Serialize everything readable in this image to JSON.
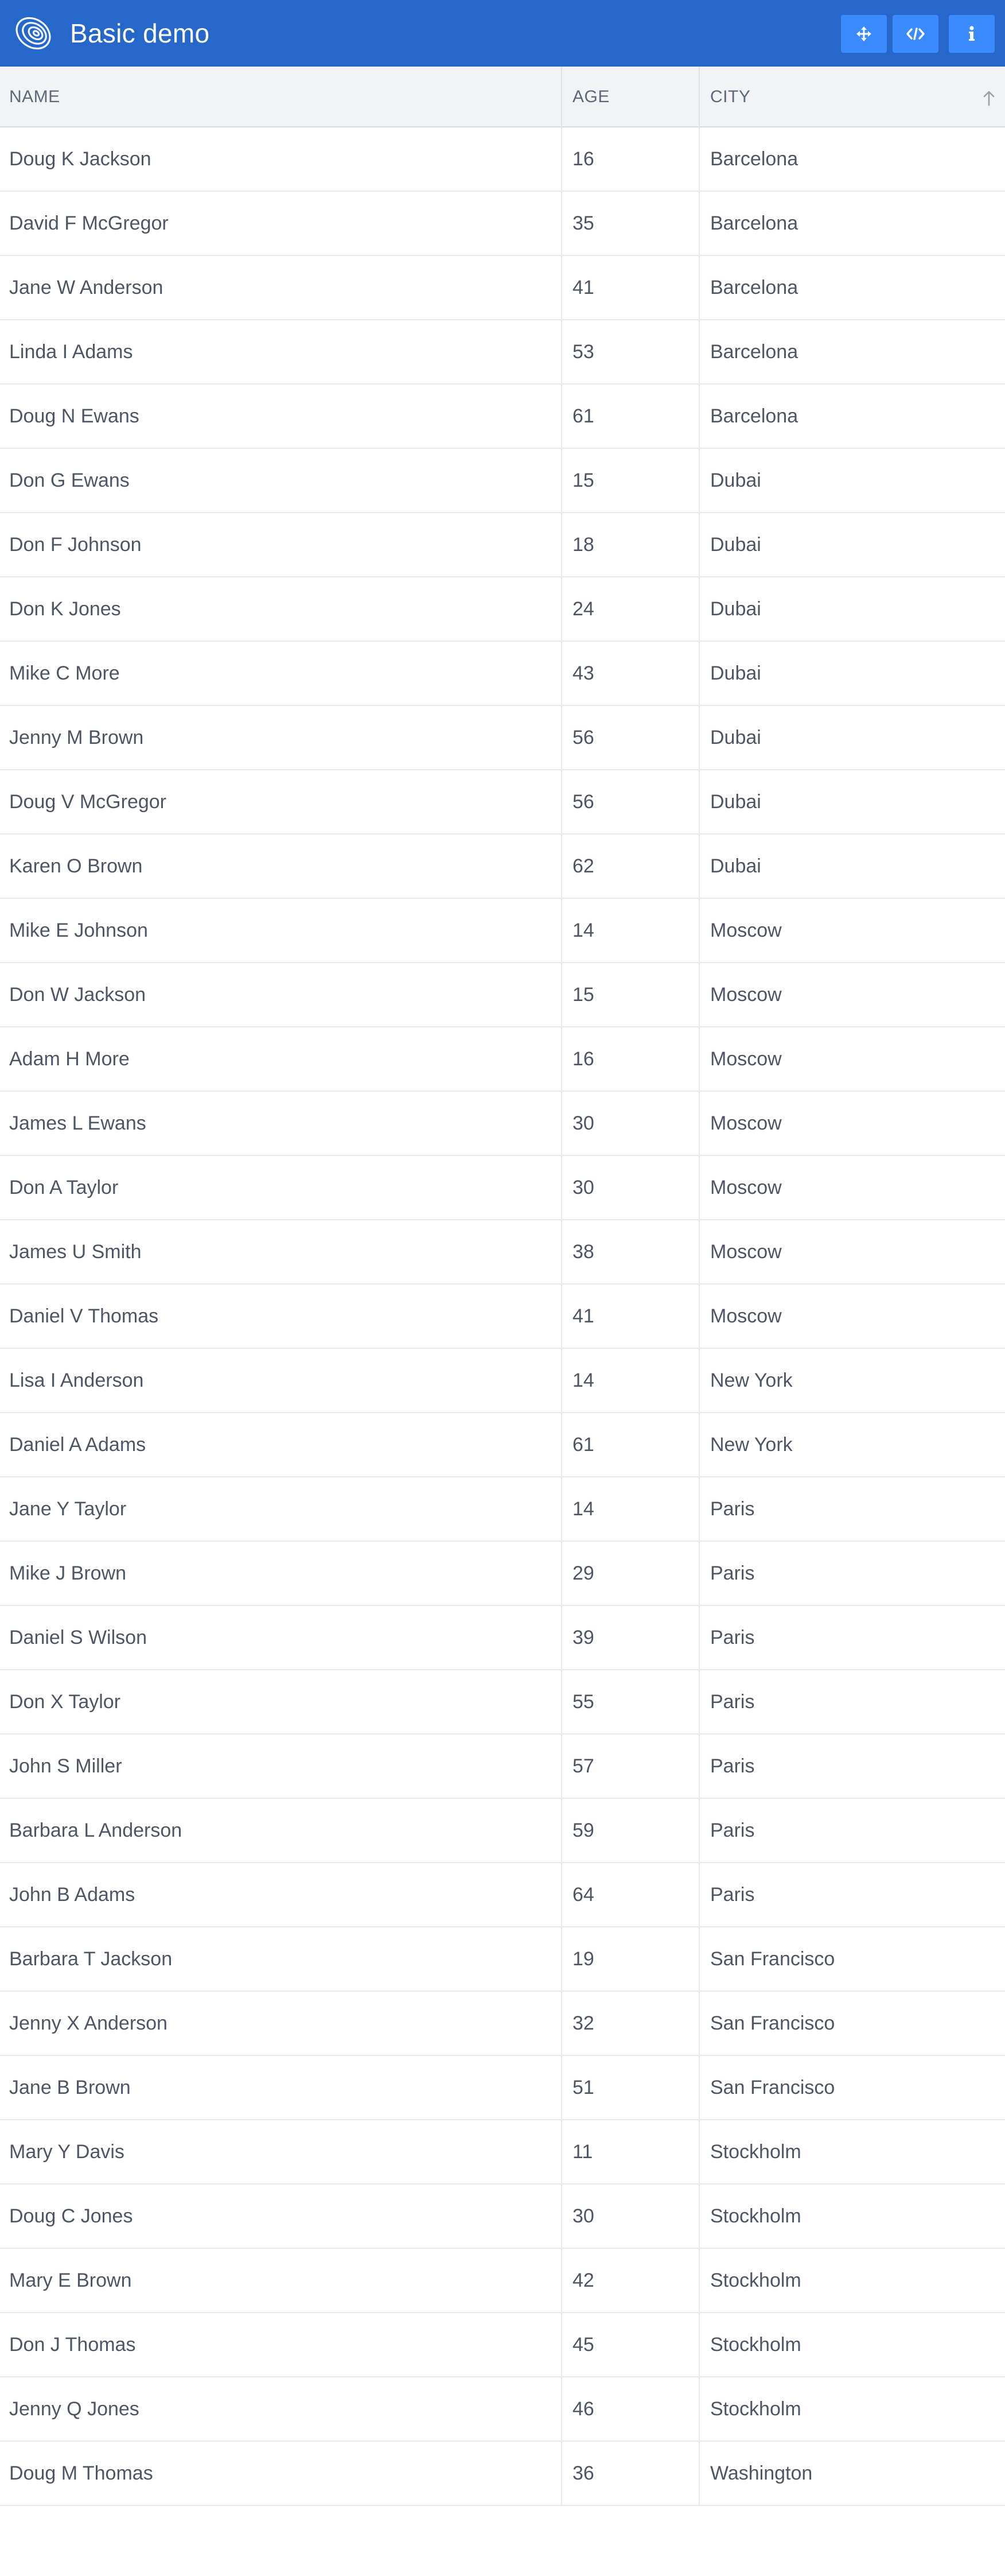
{
  "app": {
    "title": "Basic demo",
    "accent": "#2568c9",
    "button_color": "#3b8bff"
  },
  "toolbar": {
    "buttons": [
      {
        "icon": "move-arrows-icon"
      },
      {
        "icon": "code-icon"
      },
      {
        "icon": "info-icon"
      }
    ]
  },
  "table": {
    "columns": [
      {
        "key": "name",
        "label": "NAME"
      },
      {
        "key": "age",
        "label": "AGE"
      },
      {
        "key": "city",
        "label": "CITY",
        "sort": "ascending"
      }
    ],
    "rows": [
      {
        "name": "Doug K Jackson",
        "age": "16",
        "city": "Barcelona"
      },
      {
        "name": "David F McGregor",
        "age": "35",
        "city": "Barcelona"
      },
      {
        "name": "Jane W Anderson",
        "age": "41",
        "city": "Barcelona"
      },
      {
        "name": "Linda I Adams",
        "age": "53",
        "city": "Barcelona"
      },
      {
        "name": "Doug N Ewans",
        "age": "61",
        "city": "Barcelona"
      },
      {
        "name": "Don G Ewans",
        "age": "15",
        "city": "Dubai"
      },
      {
        "name": "Don F Johnson",
        "age": "18",
        "city": "Dubai"
      },
      {
        "name": "Don K Jones",
        "age": "24",
        "city": "Dubai"
      },
      {
        "name": "Mike C More",
        "age": "43",
        "city": "Dubai"
      },
      {
        "name": "Jenny M Brown",
        "age": "56",
        "city": "Dubai"
      },
      {
        "name": "Doug V McGregor",
        "age": "56",
        "city": "Dubai"
      },
      {
        "name": "Karen O Brown",
        "age": "62",
        "city": "Dubai"
      },
      {
        "name": "Mike E Johnson",
        "age": "14",
        "city": "Moscow"
      },
      {
        "name": "Don W Jackson",
        "age": "15",
        "city": "Moscow"
      },
      {
        "name": "Adam H More",
        "age": "16",
        "city": "Moscow"
      },
      {
        "name": "James L Ewans",
        "age": "30",
        "city": "Moscow"
      },
      {
        "name": "Don A Taylor",
        "age": "30",
        "city": "Moscow"
      },
      {
        "name": "James U Smith",
        "age": "38",
        "city": "Moscow"
      },
      {
        "name": "Daniel V Thomas",
        "age": "41",
        "city": "Moscow"
      },
      {
        "name": "Lisa I Anderson",
        "age": "14",
        "city": "New York"
      },
      {
        "name": "Daniel A Adams",
        "age": "61",
        "city": "New York"
      },
      {
        "name": "Jane Y Taylor",
        "age": "14",
        "city": "Paris"
      },
      {
        "name": "Mike J Brown",
        "age": "29",
        "city": "Paris"
      },
      {
        "name": "Daniel S Wilson",
        "age": "39",
        "city": "Paris"
      },
      {
        "name": "Don X Taylor",
        "age": "55",
        "city": "Paris"
      },
      {
        "name": "John S Miller",
        "age": "57",
        "city": "Paris"
      },
      {
        "name": "Barbara L Anderson",
        "age": "59",
        "city": "Paris"
      },
      {
        "name": "John B Adams",
        "age": "64",
        "city": "Paris"
      },
      {
        "name": "Barbara T Jackson",
        "age": "19",
        "city": "San Francisco"
      },
      {
        "name": "Jenny X Anderson",
        "age": "32",
        "city": "San Francisco"
      },
      {
        "name": "Jane B Brown",
        "age": "51",
        "city": "San Francisco"
      },
      {
        "name": "Mary Y Davis",
        "age": "11",
        "city": "Stockholm"
      },
      {
        "name": "Doug C Jones",
        "age": "30",
        "city": "Stockholm"
      },
      {
        "name": "Mary E Brown",
        "age": "42",
        "city": "Stockholm"
      },
      {
        "name": "Don J Thomas",
        "age": "45",
        "city": "Stockholm"
      },
      {
        "name": "Jenny Q Jones",
        "age": "46",
        "city": "Stockholm"
      },
      {
        "name": "Doug M Thomas",
        "age": "36",
        "city": "Washington"
      }
    ]
  }
}
